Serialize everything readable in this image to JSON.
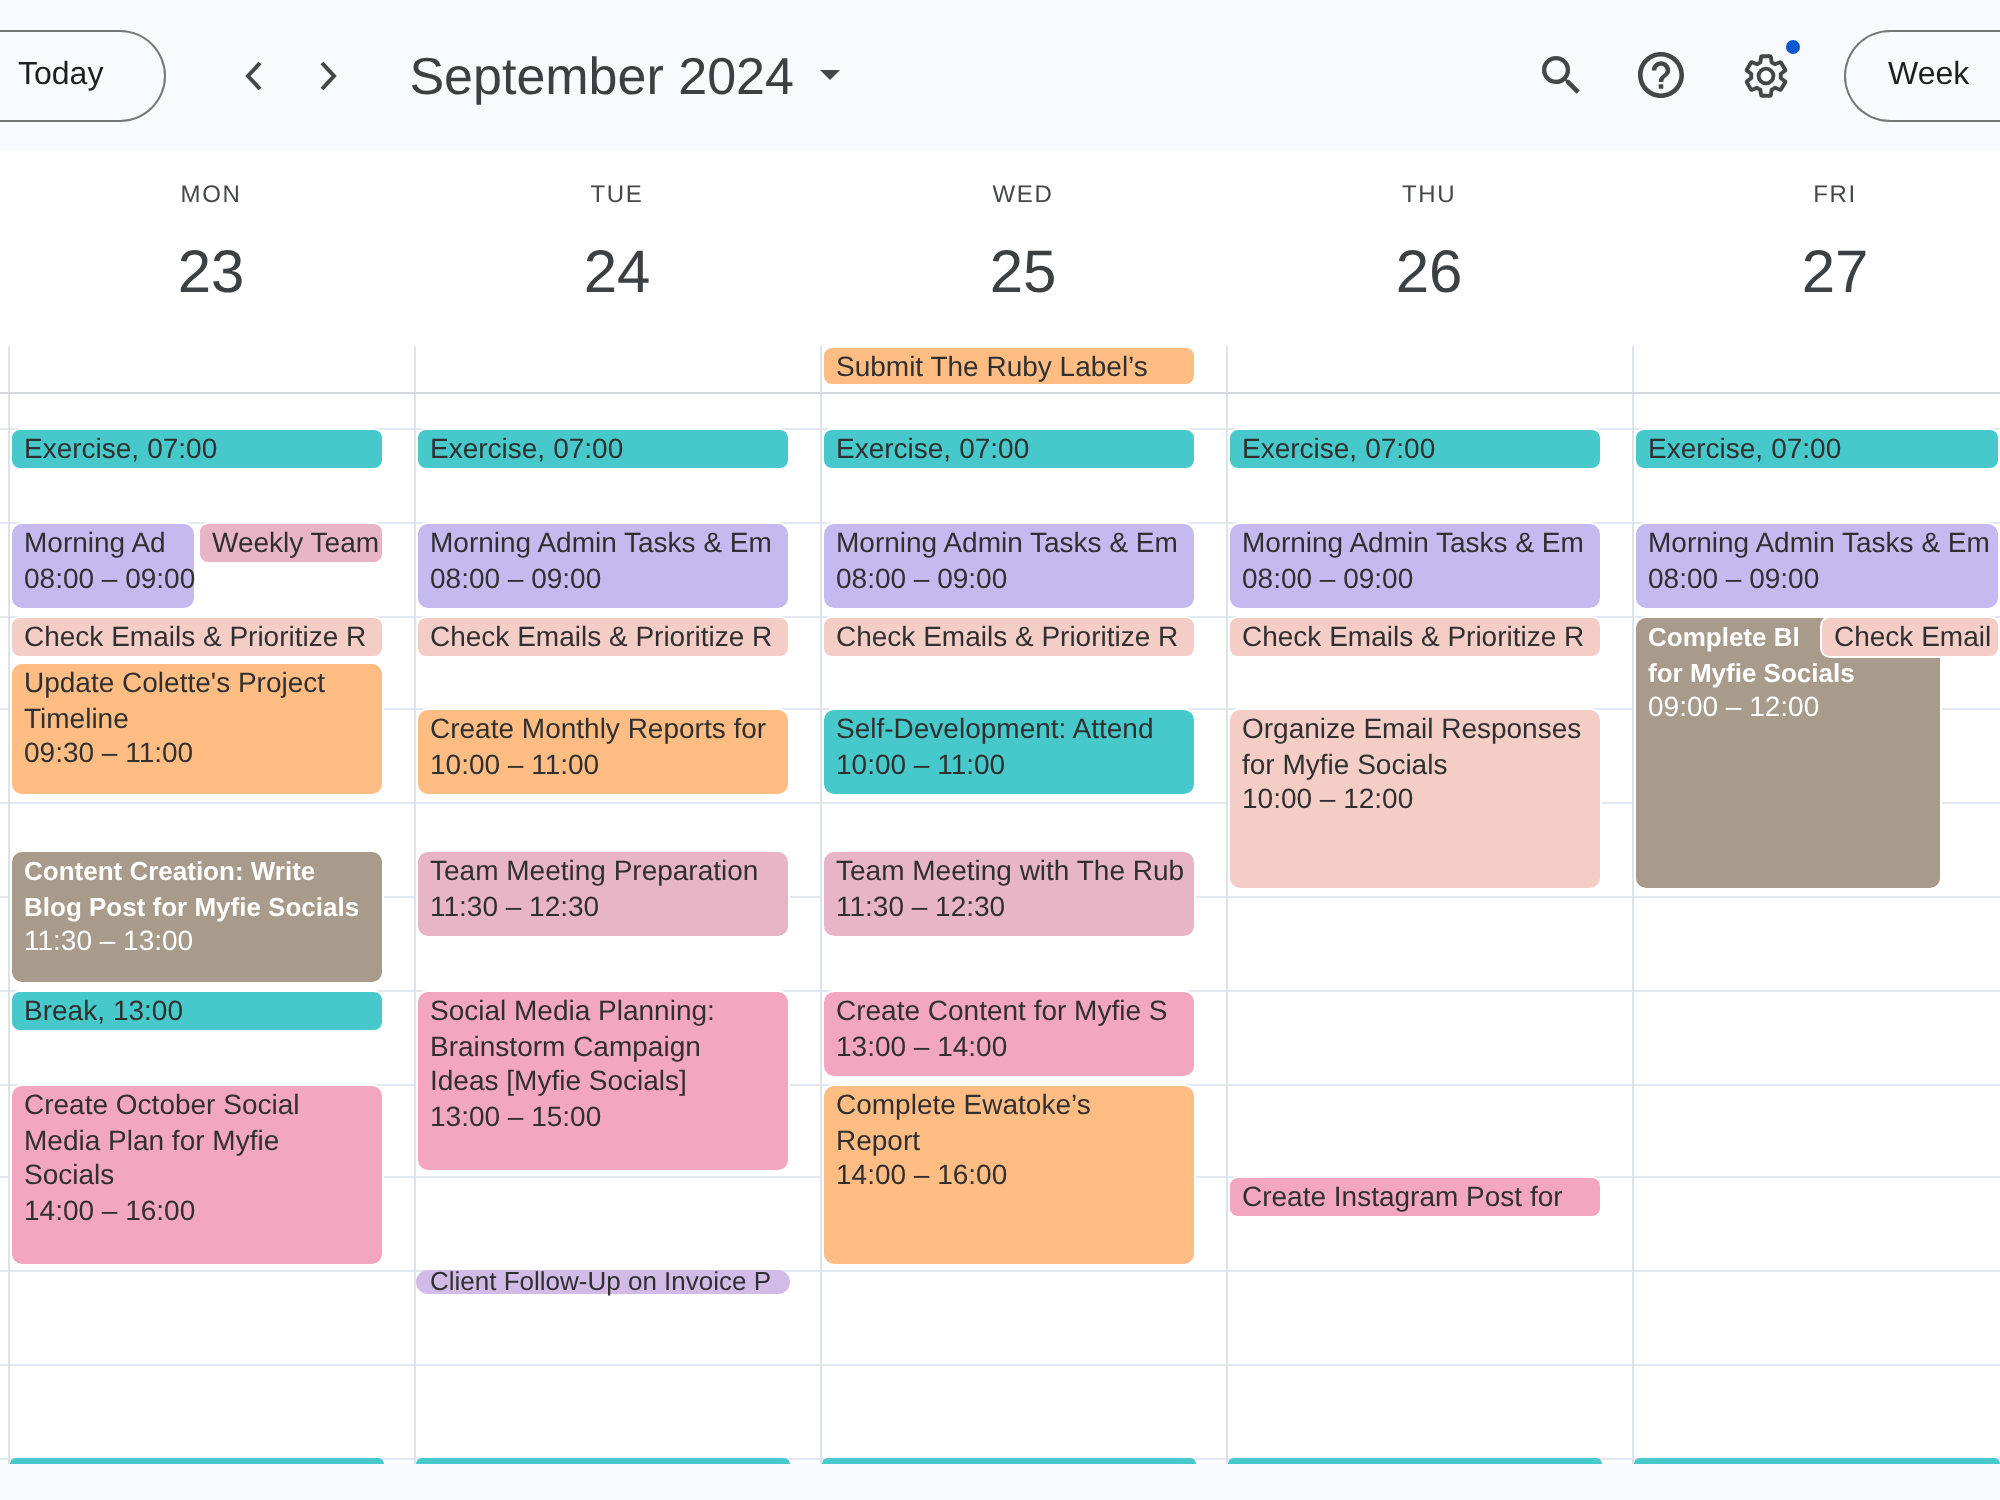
{
  "toolbar": {
    "today": "Today",
    "title": "September 2024",
    "notification_dot": true,
    "view": "Week"
  },
  "days": [
    {
      "weekday": "MON",
      "date": "23",
      "events": [
        {
          "kind": "chip",
          "title": "Exercise,",
          "time": "07:00",
          "color": "#47c8ca"
        },
        {
          "kind": "block",
          "title": "Morning Ad",
          "time": "08:00 – 09:00",
          "color": "#c4baf0"
        },
        {
          "kind": "chip",
          "title": "Weekly Team",
          "color": "#e8b5c6"
        },
        {
          "kind": "chip",
          "title": "Check Emails & Prioritize R",
          "color": "#f3cdc6"
        },
        {
          "kind": "block",
          "title": "Update Colette's Project Timeline",
          "time": "09:30 – 11:00",
          "color": "#ffbd84"
        },
        {
          "kind": "block",
          "title": "Content Creation: Write Blog Post for Myfie Socials",
          "time": "11:30 – 13:00",
          "color": "#a89b8c"
        },
        {
          "kind": "chip",
          "title": "Break,",
          "time": "13:00",
          "color": "#47c8ca"
        },
        {
          "kind": "block",
          "title": "Create October Social Media Plan for Myfie Socials",
          "time": "14:00 – 16:00",
          "color": "#f2a6bf"
        },
        {
          "kind": "edge",
          "color": "#47c8ca"
        }
      ]
    },
    {
      "weekday": "TUE",
      "date": "24",
      "events": [
        {
          "kind": "chip",
          "title": "Exercise,",
          "time": "07:00",
          "color": "#47c8ca"
        },
        {
          "kind": "block",
          "title": "Morning Admin Tasks & Em",
          "time": "08:00 – 09:00",
          "color": "#c4baf0"
        },
        {
          "kind": "chip",
          "title": "Check Emails & Prioritize R",
          "color": "#f3cdc6"
        },
        {
          "kind": "block",
          "title": "Create Monthly Reports for",
          "time": "10:00 – 11:00",
          "color": "#ffbd84"
        },
        {
          "kind": "block",
          "title": "Team Meeting Preparation",
          "time": "11:30 – 12:30",
          "color": "#e8b5c6"
        },
        {
          "kind": "block",
          "title": "Social Media Planning: Brainstorm Campaign Ideas [Myfie Socials]",
          "time": "13:00 – 15:00",
          "color": "#f2a6bf"
        },
        {
          "kind": "chip",
          "title": "Client Follow-Up on Invoice P",
          "color": "#d3bbe8"
        },
        {
          "kind": "edge",
          "color": "#47c8ca"
        }
      ]
    },
    {
      "weekday": "WED",
      "date": "25",
      "all_day": [
        {
          "kind": "chip",
          "title": "Submit The Ruby Label’s",
          "color": "#ffbd84"
        }
      ],
      "events": [
        {
          "kind": "chip",
          "title": "Exercise,",
          "time": "07:00",
          "color": "#47c8ca"
        },
        {
          "kind": "block",
          "title": "Morning Admin Tasks & Em",
          "time": "08:00 – 09:00",
          "color": "#c4baf0"
        },
        {
          "kind": "chip",
          "title": "Check Emails & Prioritize R",
          "color": "#f3cdc6"
        },
        {
          "kind": "block",
          "title": "Self-Development: Attend",
          "time": "10:00 – 11:00",
          "color": "#47c8ca"
        },
        {
          "kind": "block",
          "title": "Team Meeting with The Rub",
          "time": "11:30 – 12:30",
          "color": "#e8b5c6"
        },
        {
          "kind": "block",
          "title": "Create Content for Myfie S",
          "time": "13:00 – 14:00",
          "color": "#f2a6bf"
        },
        {
          "kind": "block",
          "title": "Complete Ewatoke’s Report",
          "time": "14:00 – 16:00",
          "color": "#ffbd84"
        },
        {
          "kind": "edge",
          "color": "#47c8ca"
        }
      ]
    },
    {
      "weekday": "THU",
      "date": "26",
      "events": [
        {
          "kind": "chip",
          "title": "Exercise,",
          "time": "07:00",
          "color": "#47c8ca"
        },
        {
          "kind": "block",
          "title": "Morning Admin Tasks & Em",
          "time": "08:00 – 09:00",
          "color": "#c4baf0"
        },
        {
          "kind": "chip",
          "title": "Check Emails & Prioritize R",
          "color": "#f3cdc6"
        },
        {
          "kind": "block",
          "title": "Organize Email Responses for Myfie Socials",
          "time": "10:00 – 12:00",
          "color": "#f3cdc6"
        },
        {
          "kind": "chip",
          "title": "Create Instagram Post for",
          "color": "#f2a6bf"
        },
        {
          "kind": "edge",
          "color": "#47c8ca"
        }
      ]
    },
    {
      "weekday": "FRI",
      "date": "27",
      "events": [
        {
          "kind": "chip",
          "title": "Exercise,",
          "time": "07:00",
          "color": "#47c8ca"
        },
        {
          "kind": "block",
          "title": "Morning Admin Tasks & Em",
          "time": "08:00 – 09:00",
          "color": "#c4baf0"
        },
        {
          "kind": "block",
          "title": "Complete Bl",
          "title_continued": "for Myfie Socials",
          "time": "09:00 – 12:00",
          "color": "#a89b8c"
        },
        {
          "kind": "chip",
          "title": "Check Email",
          "color": "#f3cdc6"
        },
        {
          "kind": "edge",
          "color": "#47c8ca"
        }
      ]
    }
  ]
}
